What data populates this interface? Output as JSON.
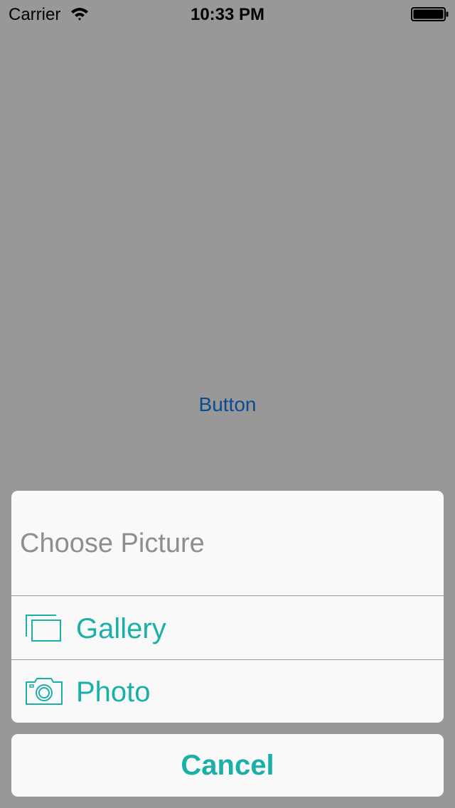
{
  "status_bar": {
    "carrier": "Carrier",
    "time": "10:33 PM",
    "wifi_icon": "wifi-icon",
    "battery_icon": "battery-icon"
  },
  "main": {
    "button_label": "Button"
  },
  "action_sheet": {
    "title": "Choose Picture",
    "options": [
      {
        "label": "Gallery",
        "icon": "gallery-icon"
      },
      {
        "label": "Photo",
        "icon": "camera-icon"
      }
    ],
    "cancel_label": "Cancel"
  },
  "colors": {
    "accent": "#1bb0a7",
    "button_blue": "#0b4a94",
    "dim_background": "#989898",
    "sheet_background": "#f9f9f9",
    "title_gray": "#8e8e8e"
  }
}
